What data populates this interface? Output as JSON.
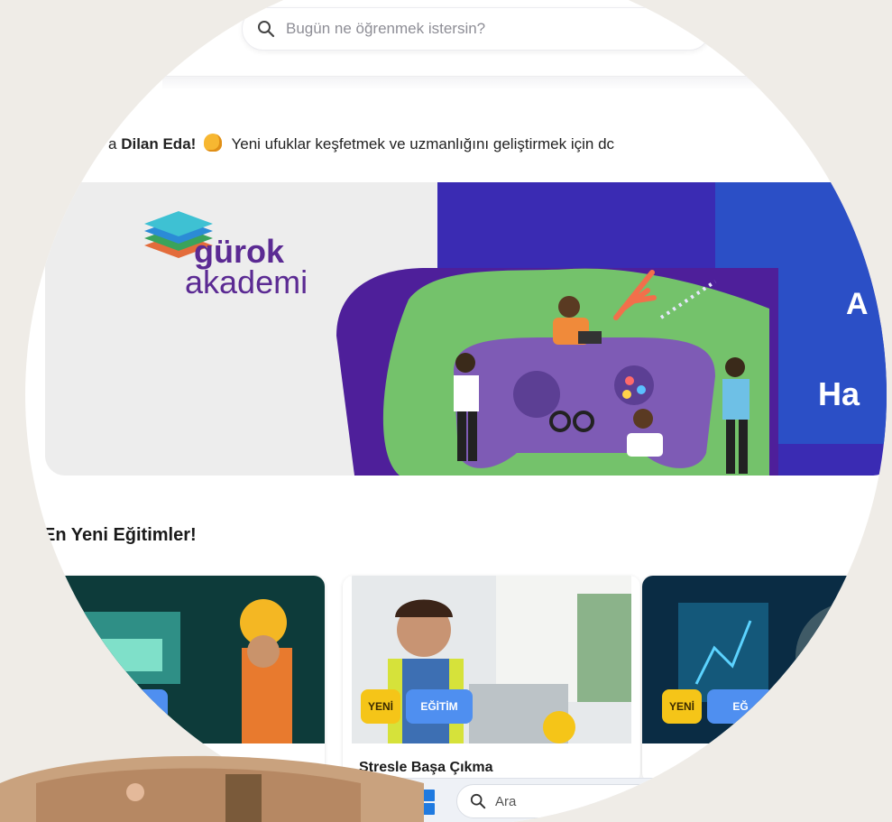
{
  "search": {
    "placeholder": "Bugün ne öğrenmek istersin?"
  },
  "greeting": {
    "prefix": "a ",
    "name": "Dilan Eda!",
    "message": "Yeni ufuklar keşfetmek ve uzmanlığını geliştirmek için dc"
  },
  "banner": {
    "brand_line1": "gürok",
    "brand_line2": "akademi",
    "partial_letter": "A",
    "partial_word": "Ha"
  },
  "section": {
    "title": "En Yeni Eğitimler!"
  },
  "cards": [
    {
      "title": "",
      "badge_yeni": "",
      "badge_egitim": ""
    },
    {
      "title": "Stresle Başa Çıkma",
      "badge_yeni": "YENİ",
      "badge_egitim": "EĞİTİM"
    },
    {
      "title": "",
      "badge_yeni": "YENİ",
      "badge_egitim": "EĞ"
    }
  ],
  "taskbar": {
    "search_label": "Ara"
  },
  "colors": {
    "brand_purple": "#5b2a93",
    "banner_blue": "#2b4fc6",
    "badge_yellow": "#f5c518",
    "badge_blue": "#4f8ff0"
  }
}
